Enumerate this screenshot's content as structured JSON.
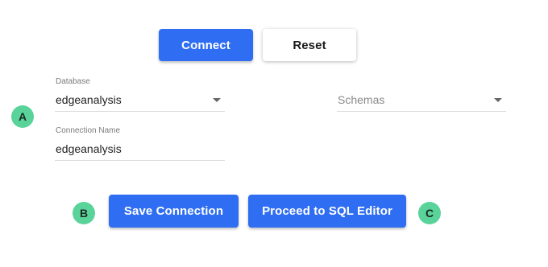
{
  "toolbar": {
    "connect_label": "Connect",
    "reset_label": "Reset"
  },
  "form": {
    "database": {
      "label": "Database",
      "value": "edgeanalysis"
    },
    "schemas": {
      "placeholder": "Schemas"
    },
    "connection_name": {
      "label": "Connection Name",
      "value": "edgeanalysis"
    }
  },
  "actions": {
    "save_label": "Save Connection",
    "proceed_label": "Proceed to SQL Editor"
  },
  "markers": {
    "a": "A",
    "b": "B",
    "c": "C"
  },
  "colors": {
    "primary": "#2f6ef2",
    "marker": "#5ad39a"
  }
}
